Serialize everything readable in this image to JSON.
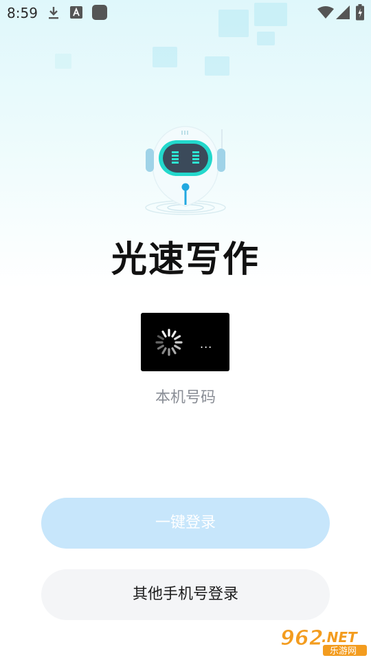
{
  "status_bar": {
    "time": "8:59",
    "icons_left": [
      "download-icon",
      "a-icon",
      "square-app-icon"
    ],
    "icons_right": [
      "wifi-icon",
      "signal-icon",
      "battery-icon"
    ]
  },
  "app": {
    "title": "光速写作"
  },
  "login": {
    "masked_number": "...",
    "number_label": "本机号码",
    "one_click_button": "一键登录",
    "other_number_button": "其他手机号登录"
  },
  "watermark": {
    "brand_number": "962",
    "brand_suffix": ".NET",
    "brand_sub": "乐游网"
  },
  "colors": {
    "accent": "#c7e6fb",
    "robot_teal": "#1fd6c8",
    "title": "#111111",
    "label_gray": "#8a8e96"
  }
}
